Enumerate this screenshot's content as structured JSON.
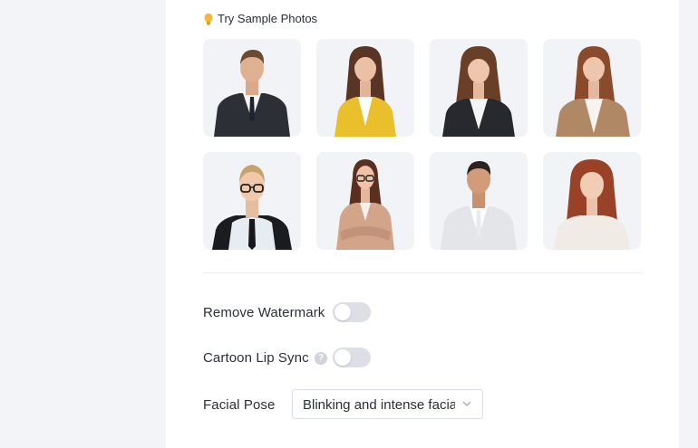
{
  "sample_section": {
    "title": "Try Sample Photos",
    "photos": [
      {
        "label": "man-dark-suit"
      },
      {
        "label": "woman-yellow-blazer"
      },
      {
        "label": "woman-black-blazer"
      },
      {
        "label": "woman-beige-blazer"
      },
      {
        "label": "woman-glasses-tie"
      },
      {
        "label": "woman-glasses-arms-crossed"
      },
      {
        "label": "man-white-suit"
      },
      {
        "label": "woman-red-hair-blouse"
      }
    ]
  },
  "settings": {
    "remove_watermark": {
      "label": "Remove Watermark",
      "enabled": false
    },
    "cartoon_lip_sync": {
      "label": "Cartoon Lip Sync",
      "enabled": false,
      "help": "?"
    },
    "facial_pose": {
      "label": "Facial Pose",
      "value": "Blinking and intense facial expressions"
    }
  },
  "colors": {
    "page_bg": "#f3f4f7",
    "panel_bg": "#ffffff",
    "toggle_off": "#dcdfe6",
    "bulb": "#f5b82e"
  }
}
